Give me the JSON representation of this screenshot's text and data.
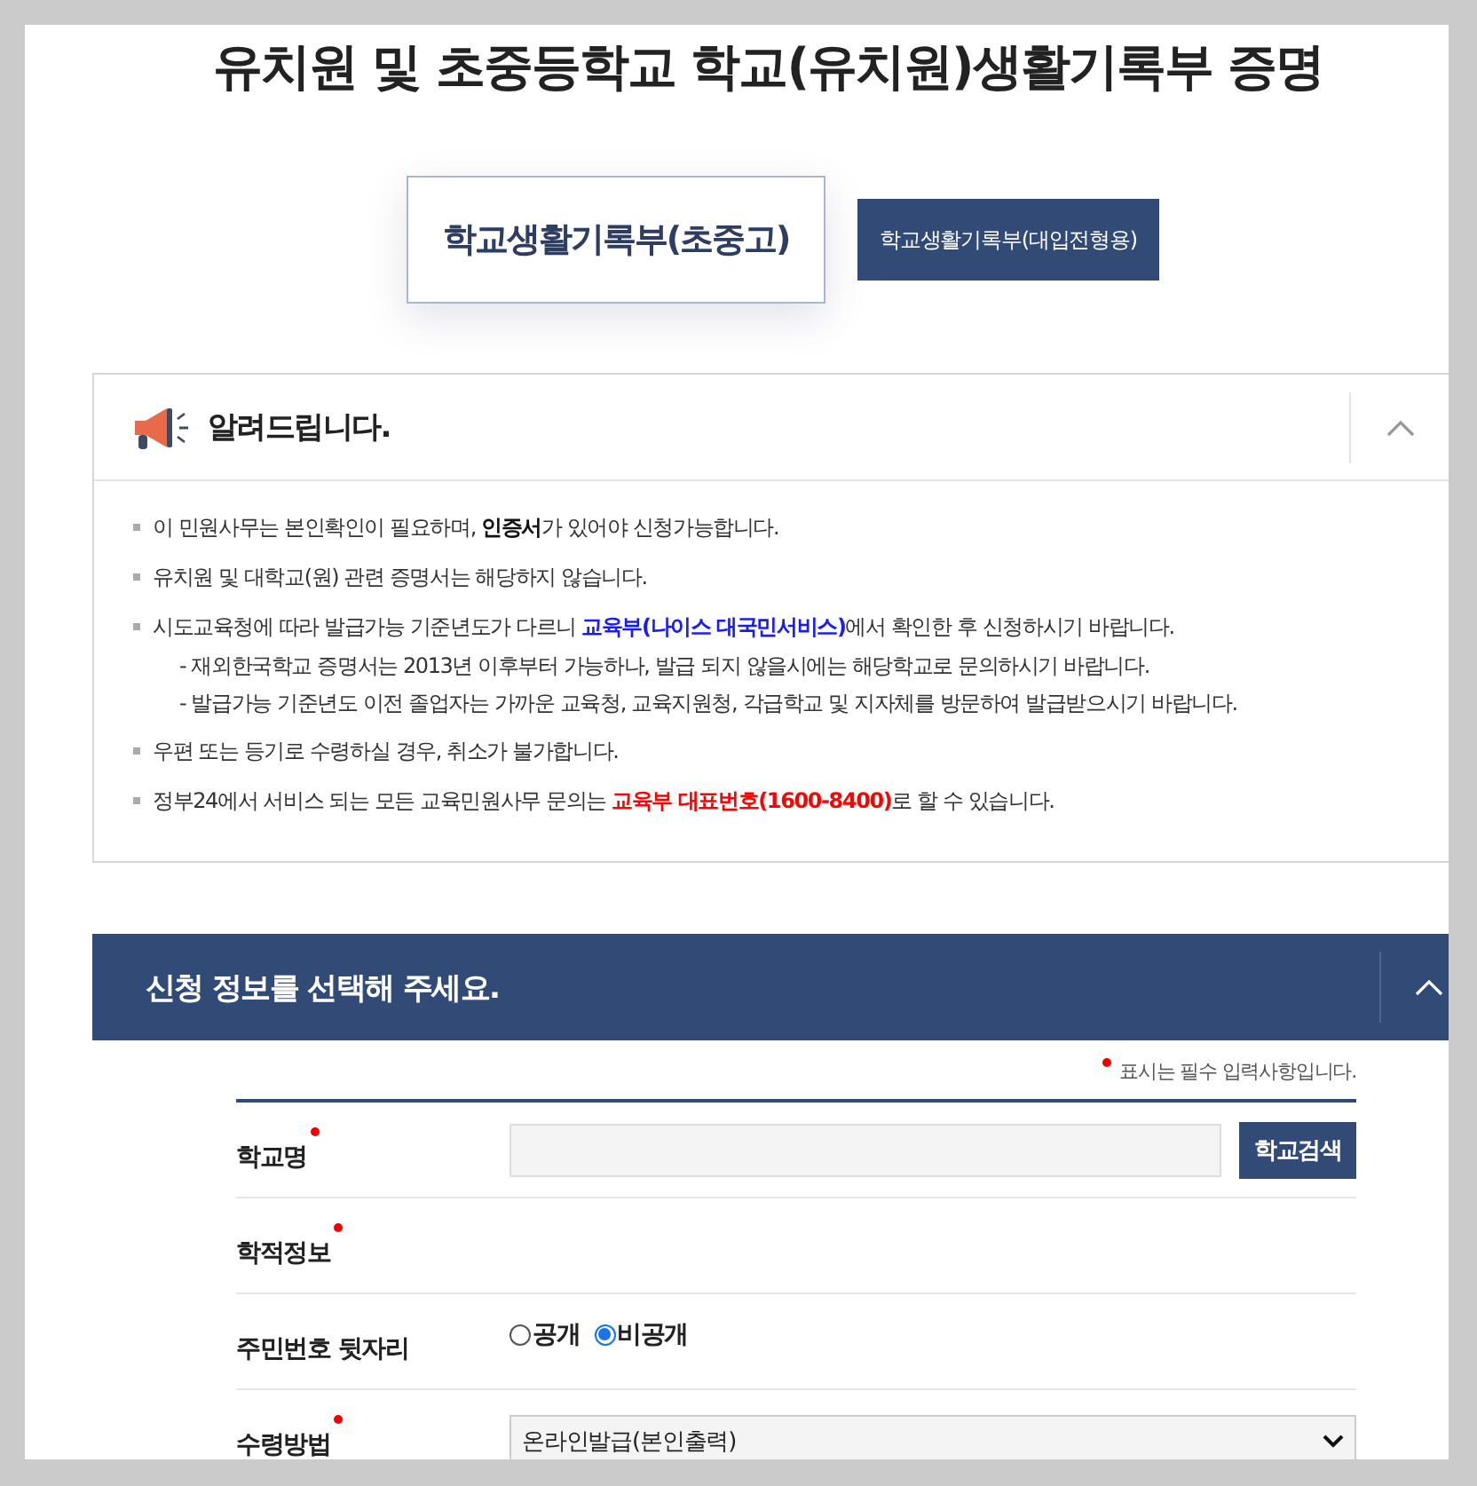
{
  "page_title": "유치원 및 초중등학교 학교(유치원)생활기록부 증명",
  "tabs": [
    {
      "label": "학교생활기록부(초중고)",
      "selected": true
    },
    {
      "label": "학교생활기록부(대입전형용)",
      "selected": false
    }
  ],
  "notice": {
    "title": "알려드립니다.",
    "expanded": true,
    "items": [
      {
        "parts": [
          {
            "text": "이 민원사무는 본인확인이 필요하며, **인증서**가 있어야 신청가능합니다."
          }
        ]
      },
      {
        "parts": [
          {
            "text": "유치원 및 대학교(원) 관련 증명서는 해당하지 않습니다."
          }
        ]
      },
      {
        "parts": [
          {
            "text": "시도교육청에 따라 발급가능 기준년도가 다르니 "
          },
          {
            "text": "교육부(나이스 대국민서비스)",
            "color": "#1a1aff"
          },
          {
            "text": "에서 확인한 후 신청하시기 바랍니다."
          }
        ],
        "subitems": [
          "- 재외한국학교 증명서는 2013년 이후부터 가능하나, 발급 되지 않을시에는 해당학교로 문의하시기 바랍니다.",
          "- 발급가능 기준년도 이전 졸업자는 가까운 교육청, 교육지원청, 각급학교 및 지자체를 방문하여 발급받으시기 바랍니다."
        ]
      },
      {
        "parts": [
          {
            "text": "우편 또는 등기로 수령하실 경우, 취소가 불가합니다."
          }
        ]
      },
      {
        "parts": [
          {
            "text": "정부24에서 서비스 되는 모든 교육민원사무 문의는 "
          },
          {
            "text": "교육부 대표번호(1600-8400)",
            "color": "#ff0000"
          },
          {
            "text": "로 할 수 있습니다."
          }
        ]
      }
    ]
  },
  "form": {
    "title": "신청 정보를 선택해 주세요.",
    "expanded": true,
    "required_note": "표시는 필수 입력사항입니다.",
    "fields": [
      {
        "kind": "search",
        "label": "학교명",
        "required": true,
        "button": "학교검색"
      },
      {
        "kind": "empty",
        "label": "학적정보",
        "required": true
      },
      {
        "kind": "radio",
        "label": "주민번호 뒷자리",
        "required": false,
        "options": [
          {
            "label": "공개",
            "selected": false
          },
          {
            "label": "비공개",
            "selected": true
          }
        ]
      },
      {
        "kind": "select",
        "label": "수령방법",
        "required": true,
        "value": "온라인발급(본인출력)"
      }
    ]
  }
}
